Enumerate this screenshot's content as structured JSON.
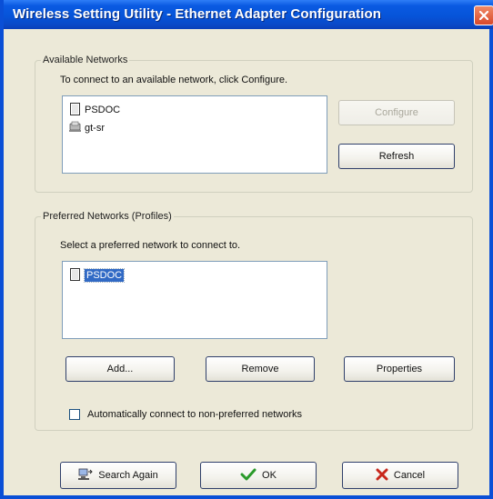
{
  "window": {
    "title": "Wireless Setting Utility - Ethernet Adapter Configuration",
    "close_label": "Close"
  },
  "available_networks": {
    "legend": "Available Networks",
    "instruction": "To connect to an available network, click Configure.",
    "items": [
      {
        "label": "PSDOC",
        "icon": "access-point-icon"
      },
      {
        "label": "gt-sr",
        "icon": "ad-hoc-network-icon"
      }
    ],
    "configure_label": "Configure",
    "refresh_label": "Refresh"
  },
  "preferred_networks": {
    "legend": "Preferred Networks (Profiles)",
    "instruction": "Select a preferred network to connect to.",
    "items": [
      {
        "label": "PSDOC",
        "icon": "access-point-icon",
        "selected": true
      }
    ],
    "add_label": "Add...",
    "remove_label": "Remove",
    "properties_label": "Properties"
  },
  "auto_connect": {
    "label": "Automatically connect to non-preferred networks",
    "checked": false
  },
  "footer": {
    "search_again_label": "Search Again",
    "ok_label": "OK",
    "cancel_label": "Cancel"
  },
  "colors": {
    "titlebar": "#0654d9",
    "dialog_bg": "#ece9d8",
    "selection": "#316ac5",
    "ok_check": "#2a9a2a",
    "cancel_x": "#c8271b"
  }
}
